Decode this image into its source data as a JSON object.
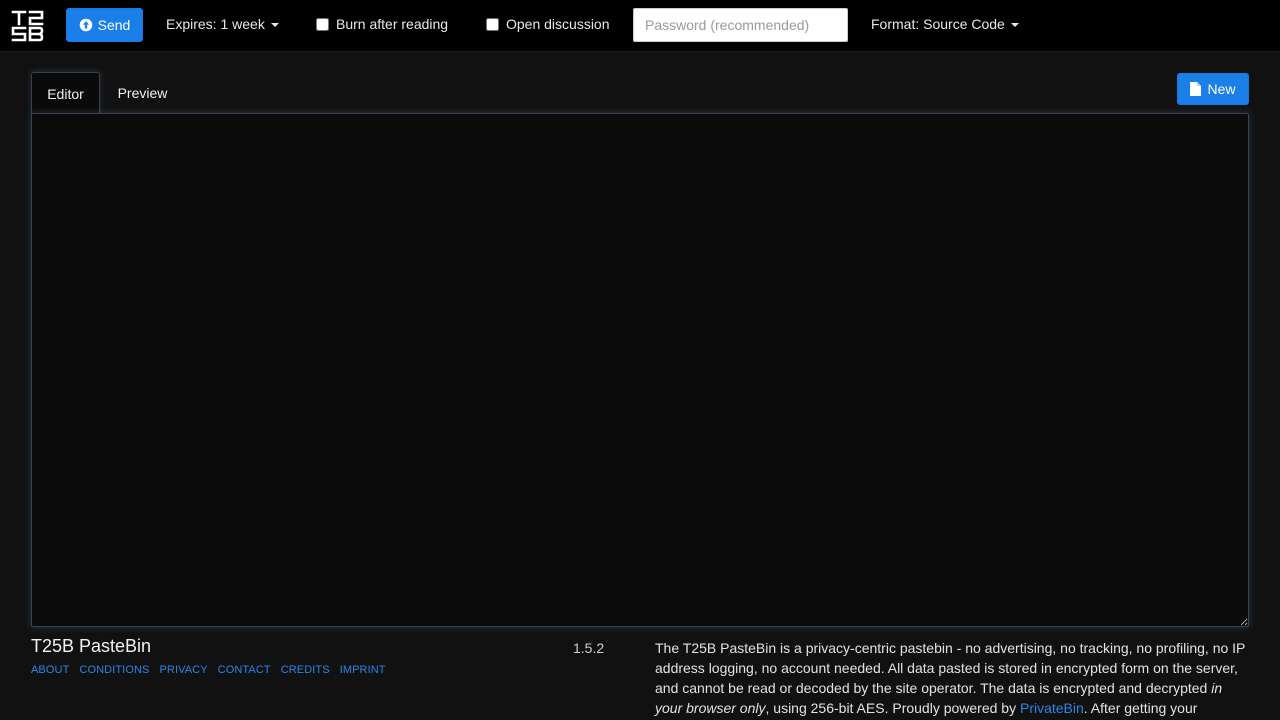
{
  "navbar": {
    "logo_text": "T25B",
    "send_label": "Send",
    "expires_label": "Expires: 1 week",
    "burn_label": "Burn after reading",
    "discussion_label": "Open discussion",
    "password_placeholder": "Password (recommended)",
    "password_value": "",
    "format_label": "Format: Source Code"
  },
  "tabs": [
    {
      "label": "Editor",
      "active": true
    },
    {
      "label": "Preview",
      "active": false
    }
  ],
  "new_label": "New",
  "editor": {
    "value": ""
  },
  "footer": {
    "title": "T25B PasteBin",
    "version": "1.5.2",
    "links": [
      "ABOUT",
      "CONDITIONS",
      "PRIVACY",
      "CONTACT",
      "CREDITS",
      "IMPRINT"
    ],
    "about": {
      "part1": "The T25B PasteBin is a privacy-centric pastebin - no advertising, no tracking, no profiling, no IP address logging, no account needed. All data pasted is stored in encrypted form on the server, and cannot be read or decoded by the site operator. The data is encrypted and decrypted ",
      "em": "in your browser only",
      "part2": ", using 256-bit AES. Proudly powered by ",
      "link": "PrivateBin",
      "part3": ". After getting your"
    }
  },
  "colors": {
    "accent": "#1a7fe8",
    "link": "#2a85e8",
    "background": "#111111",
    "navbar": "#000000"
  }
}
